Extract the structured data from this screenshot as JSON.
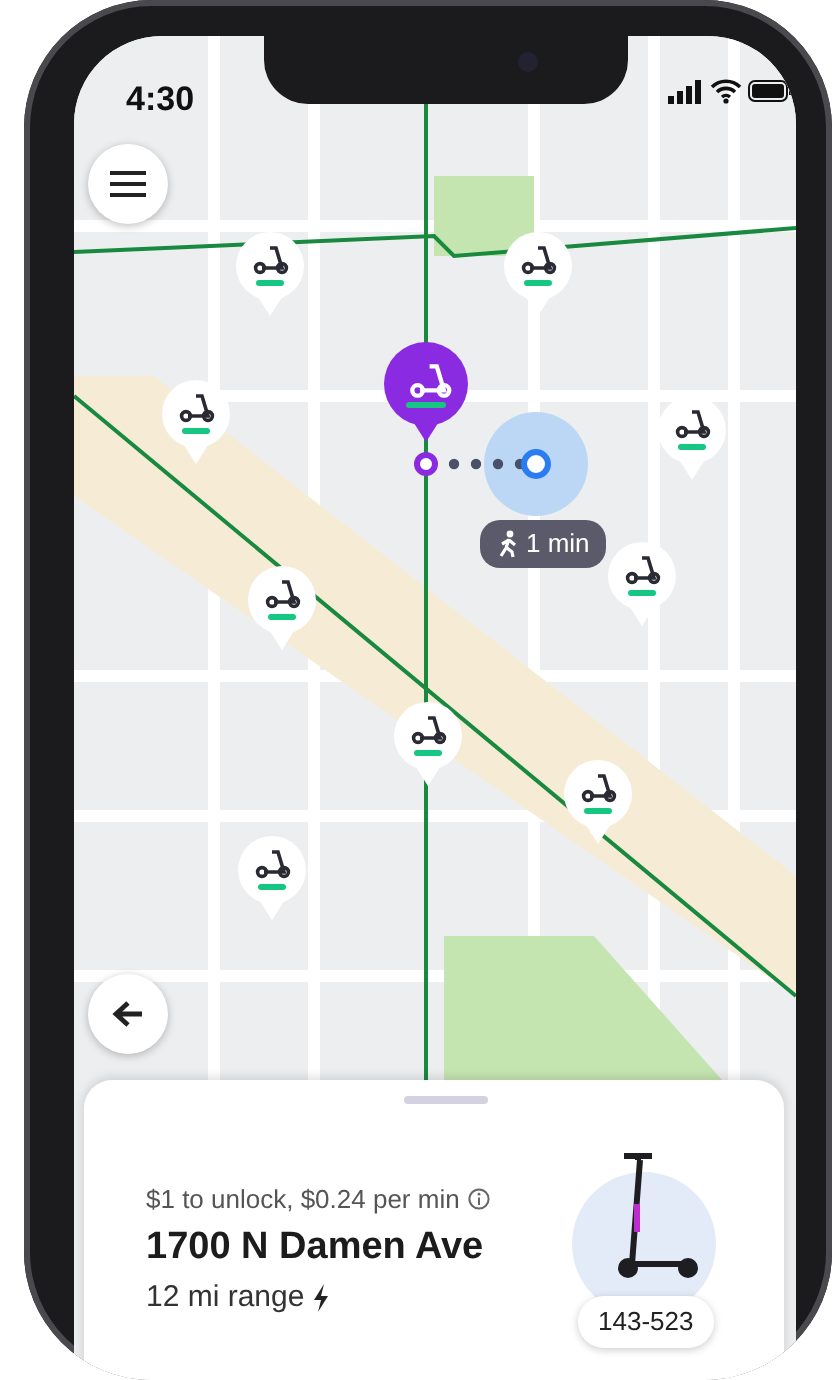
{
  "status_bar": {
    "time": "4:30"
  },
  "markers": [
    {
      "selected": false
    },
    {
      "selected": false
    },
    {
      "selected": true
    },
    {
      "selected": false
    },
    {
      "selected": false
    },
    {
      "selected": false
    },
    {
      "selected": false
    },
    {
      "selected": false
    },
    {
      "selected": false
    },
    {
      "selected": false
    }
  ],
  "walk_badge": {
    "text": "1 min"
  },
  "details": {
    "pricing": "$1 to unlock, $0.24 per min",
    "address": "1700 N Damen Ave",
    "range": "12 mi range",
    "scooter_id": "143-523"
  }
}
